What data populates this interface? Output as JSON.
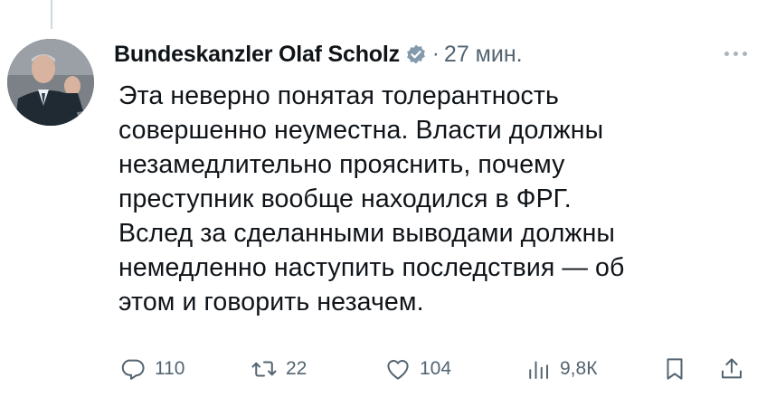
{
  "tweet": {
    "author_name": "Bundeskanzler Olaf Scholz",
    "timestamp": "27 мин.",
    "separator": "·",
    "text": "Эта неверно понятая толерантность\nсовершенно неуместна. Власти должны\nнезамедлительно прояснить, почему\nпреступник вообще находился в ФРГ.\nВслед за сделанными выводами должны\nнемедленно наступить последствия — об\nэтом и говорить незачем.",
    "verified_icon": "verified-badge-icon",
    "more_icon": "more-icon"
  },
  "actions": {
    "reply": {
      "icon": "reply-icon",
      "count": "110"
    },
    "retweet": {
      "icon": "retweet-icon",
      "count": "22"
    },
    "like": {
      "icon": "heart-icon",
      "count": "104"
    },
    "views": {
      "icon": "views-icon",
      "count": "9,8К"
    },
    "bookmark": {
      "icon": "bookmark-icon"
    },
    "share": {
      "icon": "share-icon"
    }
  },
  "colors": {
    "text": "#0f1419",
    "secondary": "#536471",
    "verified": "#829aab",
    "thread_line": "#cfd9de"
  }
}
